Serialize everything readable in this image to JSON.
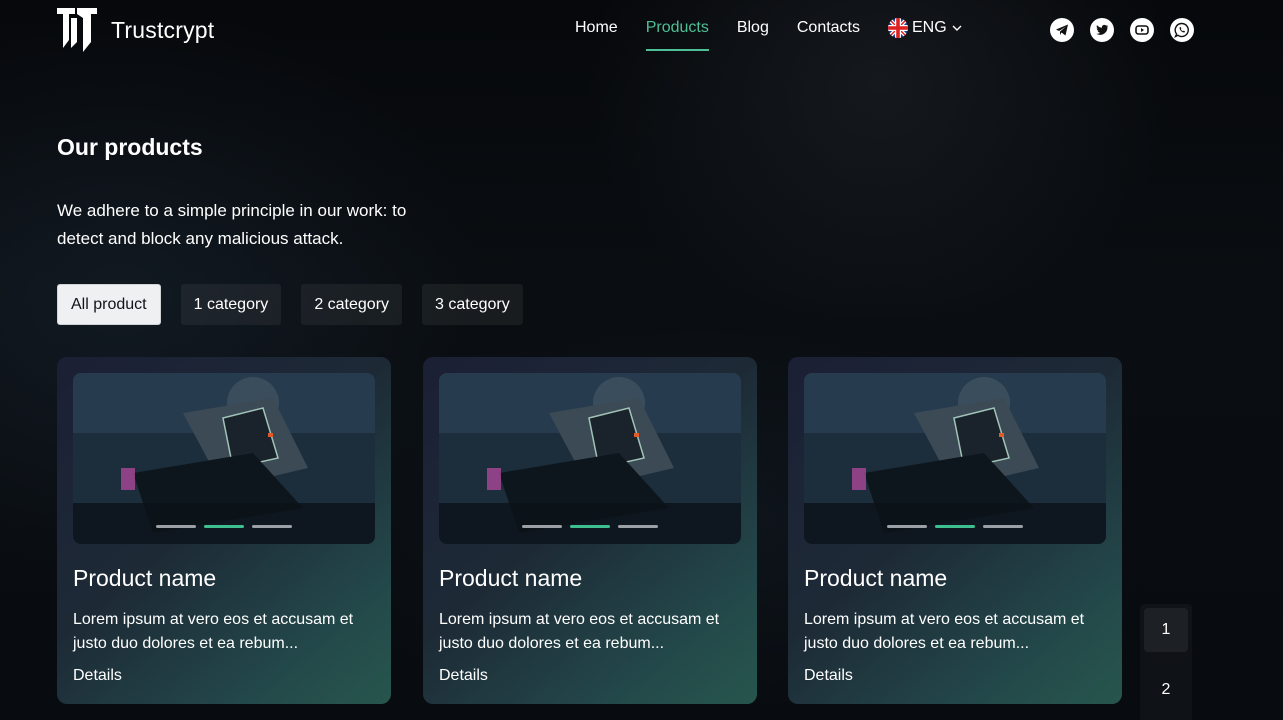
{
  "brand": {
    "name": "Trustcrypt"
  },
  "nav": {
    "items": [
      {
        "label": "Home",
        "active": false
      },
      {
        "label": "Products",
        "active": true
      },
      {
        "label": "Blog",
        "active": false
      },
      {
        "label": "Contacts",
        "active": false
      }
    ],
    "language": "ENG"
  },
  "socials": [
    "telegram-icon",
    "twitter-icon",
    "youtube-icon",
    "whatsapp-icon"
  ],
  "intro": {
    "title": "Our products",
    "subtitle": "We adhere to a simple principle in our work: to detect and block any malicious attack."
  },
  "filters": [
    "All product",
    "1 category",
    "2 category",
    "3 category"
  ],
  "cards": [
    {
      "title": "Product name",
      "description": "Lorem ipsum at vero eos et accusam et justo duo dolores et ea rebum...",
      "link": "Details"
    },
    {
      "title": "Product name",
      "description": "Lorem ipsum at vero eos et accusam et justo duo dolores et ea rebum...",
      "link": "Details"
    },
    {
      "title": "Product name",
      "description": "Lorem ipsum at vero eos et accusam et justo duo dolores et ea rebum...",
      "link": "Details"
    }
  ],
  "pagination": {
    "pages": [
      "1",
      "2"
    ],
    "current": "1"
  },
  "colors": {
    "accent": "#4fbf95",
    "background": "#05070a"
  }
}
